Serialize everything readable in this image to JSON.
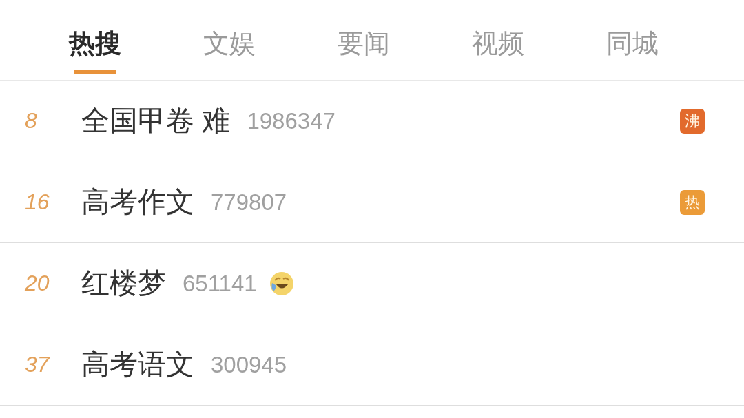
{
  "tabs": [
    {
      "label": "热搜",
      "selected": true
    },
    {
      "label": "文娱",
      "selected": false
    },
    {
      "label": "要闻",
      "selected": false
    },
    {
      "label": "视频",
      "selected": false
    },
    {
      "label": "同城",
      "selected": false
    }
  ],
  "rows": [
    {
      "rank": "8",
      "title": "全国甲卷 难",
      "count": "1986347",
      "has_emoji": false,
      "badge": {
        "text": "沸",
        "color": "#e26a2c"
      },
      "divider_below": false
    },
    {
      "rank": "16",
      "title": "高考作文",
      "count": "779807",
      "has_emoji": false,
      "badge": {
        "text": "热",
        "color": "#eb9b38"
      },
      "divider_below": true
    },
    {
      "rank": "20",
      "title": "红楼梦",
      "count": "651141",
      "has_emoji": true,
      "divider_below": true
    },
    {
      "rank": "37",
      "title": "高考语文",
      "count": "300945",
      "has_emoji": false,
      "divider_below": true
    }
  ]
}
